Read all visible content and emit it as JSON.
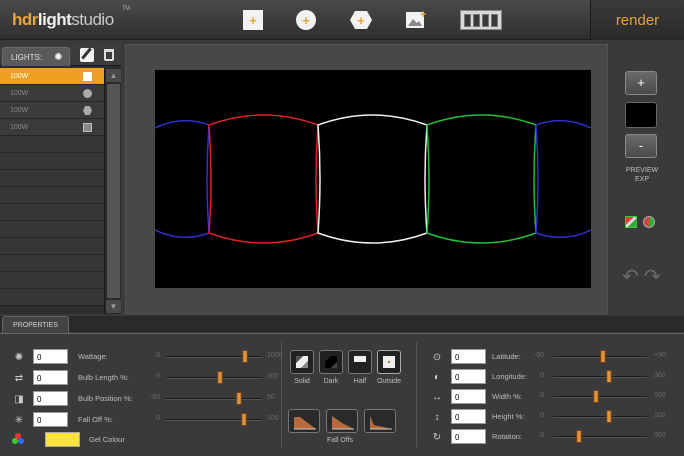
{
  "app": {
    "logo": {
      "hdr": "hdr",
      "light": "light",
      "studio": "studio",
      "tm": "TM"
    },
    "render_label": "render",
    "toolbar_icons": [
      "add-square-light-icon",
      "add-circle-light-icon",
      "add-hexagon-light-icon",
      "add-image-light-icon",
      "timeline-icon"
    ]
  },
  "lights_panel": {
    "tab_label": "LIGHTS:",
    "lights": [
      {
        "label": "100W",
        "shape": "square",
        "selected": true
      },
      {
        "label": "100W",
        "shape": "circle",
        "selected": false
      },
      {
        "label": "100W",
        "shape": "hexagon",
        "selected": false
      },
      {
        "label": "100W",
        "shape": "image",
        "selected": false
      }
    ]
  },
  "canvas": {
    "panels": [
      {
        "color": "#3030d0"
      },
      {
        "color": "#e02020"
      },
      {
        "color": "#f0f0f0"
      },
      {
        "color": "#20c030"
      },
      {
        "color": "#3030d0"
      }
    ]
  },
  "preview": {
    "plus_label": "+",
    "minus_label": "-",
    "label_line1": "PREVIEW",
    "label_line2": "EXP"
  },
  "properties": {
    "tab_label": "PROPERTIES",
    "left_rows": [
      {
        "value": "0",
        "label": "Wattage:",
        "min": "0",
        "max": "1000",
        "pos": 0.82
      },
      {
        "value": "0",
        "label": "Bulb Length %:",
        "min": "0",
        "max": "100",
        "pos": 0.56
      },
      {
        "value": "0",
        "label": "Bulb Position %:",
        "min": "-50",
        "max": "50",
        "pos": 0.76
      },
      {
        "value": "0",
        "label": "Fall Off %:",
        "min": "0",
        "max": "100",
        "pos": 0.81
      }
    ],
    "gel_label": "Gel Colour",
    "gel_color": "#ffe23a",
    "light_types": [
      "Solid",
      "Dark",
      "Half",
      "Outside"
    ],
    "falloffs_label": "Fall Offs",
    "right_rows": [
      {
        "value": "0",
        "label": "Latitude:",
        "min": "-90",
        "max": "+90",
        "pos": 0.53
      },
      {
        "value": "0",
        "label": "Longitude:",
        "min": "0",
        "max": "360",
        "pos": 0.6
      },
      {
        "value": "0",
        "label": "Width %:",
        "min": "0",
        "max": "100",
        "pos": 0.46
      },
      {
        "value": "0",
        "label": "Height %:",
        "min": "0",
        "max": "100",
        "pos": 0.6
      },
      {
        "value": "0",
        "label": "Rotation:",
        "min": "0",
        "max": "360",
        "pos": 0.28
      }
    ]
  }
}
